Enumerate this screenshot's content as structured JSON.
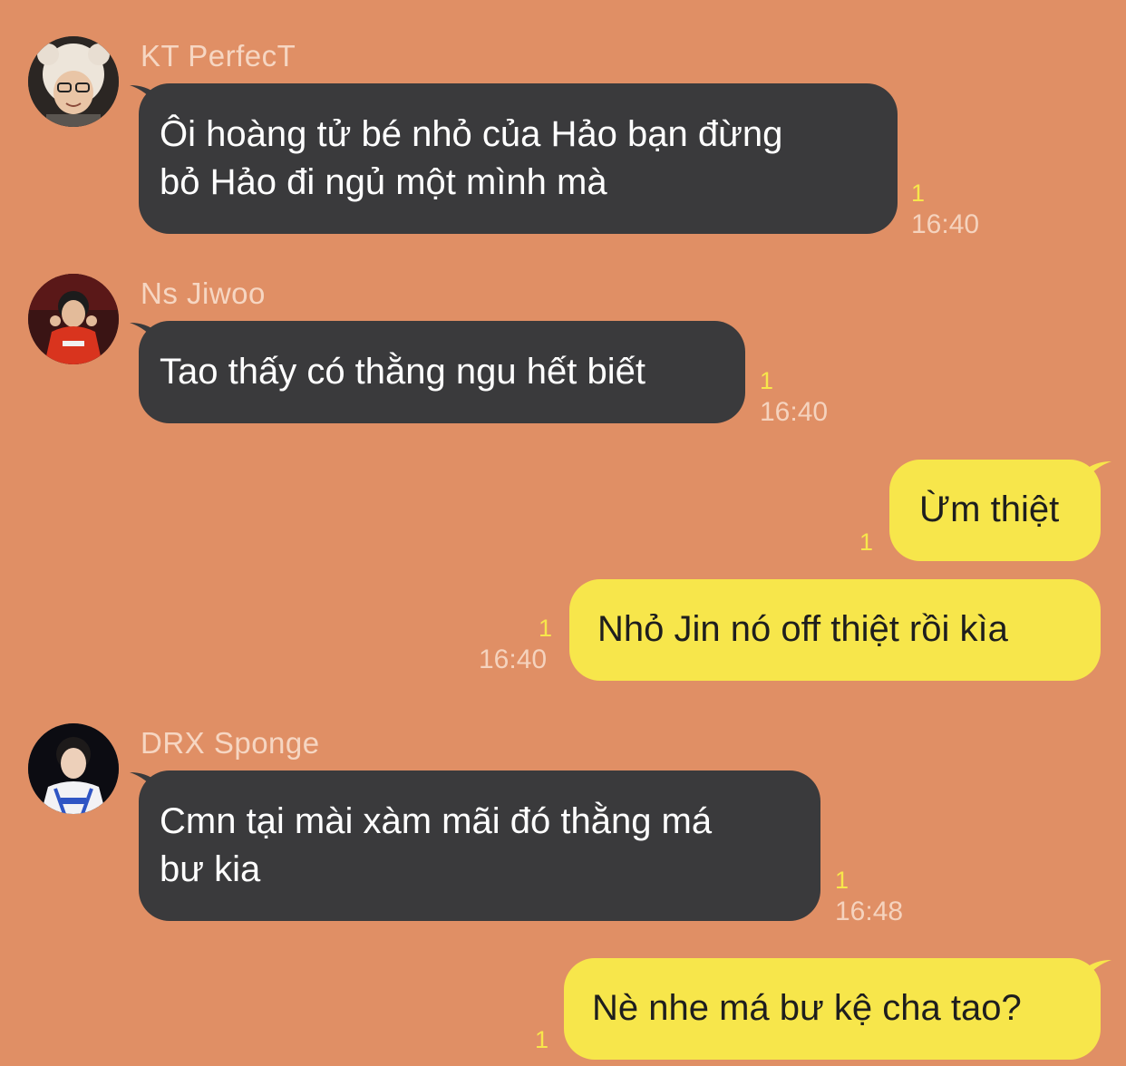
{
  "messages": [
    {
      "sender": "KT PerfecT",
      "text_lines": [
        "Ôi hoàng tử bé nhỏ của Hảo bạn đừng",
        "bỏ Hảo đi ngủ một mình mà"
      ],
      "unread": "1",
      "time": "16:40"
    },
    {
      "sender": "Ns Jiwoo",
      "text_lines": [
        "Tao thấy có thằng ngu hết biết"
      ],
      "unread": "1",
      "time": "16:40"
    },
    {
      "text_lines": [
        "Ừm thiệt"
      ],
      "unread": "1"
    },
    {
      "text_lines": [
        "Nhỏ Jin nó off thiệt rồi kìa"
      ],
      "unread": "1",
      "time": "16:40"
    },
    {
      "sender": "DRX Sponge",
      "text_lines": [
        "Cmn tại mài xàm mãi đó thằng má",
        "bư kia"
      ],
      "unread": "1",
      "time": "16:48"
    },
    {
      "text_lines": [
        "Nè nhe má bư kệ cha tao?"
      ],
      "unread": "1"
    }
  ],
  "colors": {
    "background": "#E08F65",
    "incoming_bubble": "#3A3A3C",
    "outgoing_bubble": "#F7E64B",
    "unread_count": "#F7E64B",
    "name_text": "#F6D6C2"
  },
  "icons": [
    "avatar-kt-perfect",
    "avatar-ns-jiwoo",
    "avatar-drx-sponge"
  ]
}
